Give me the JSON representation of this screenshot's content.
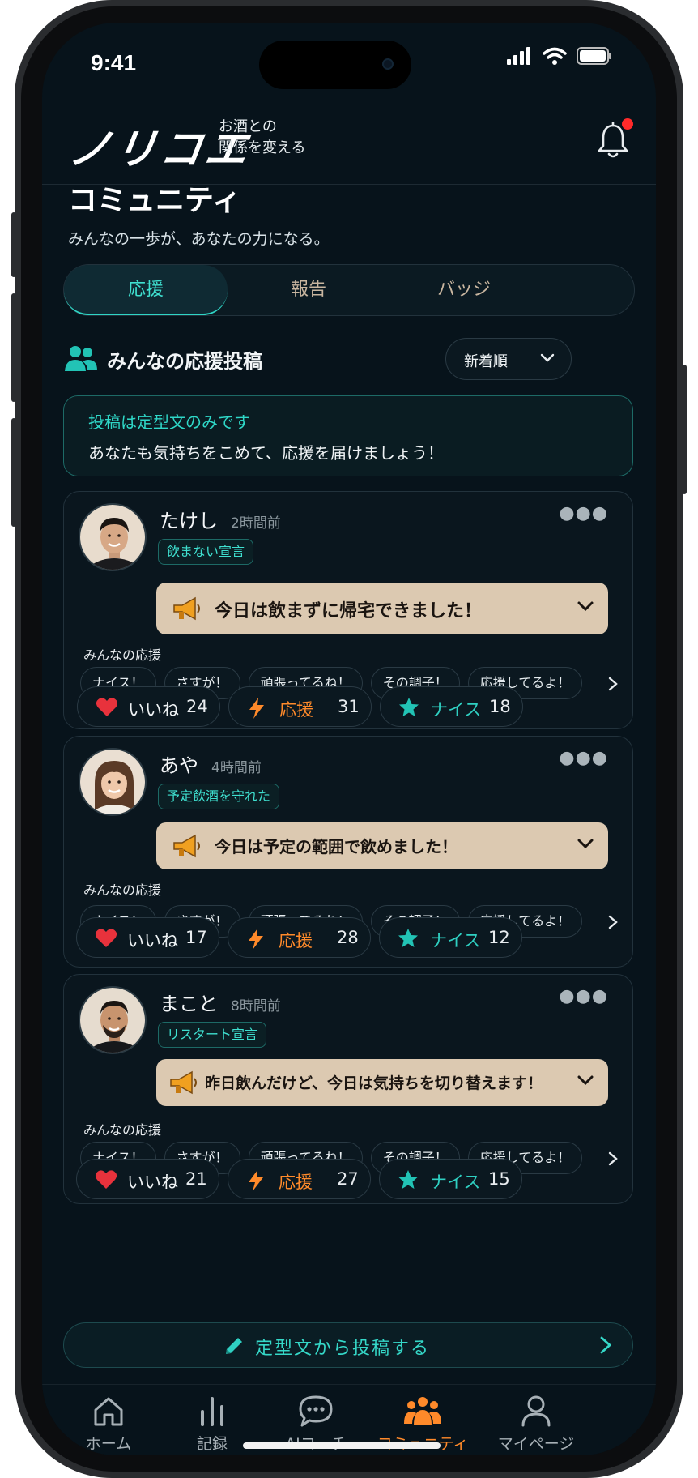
{
  "status": {
    "time": "9:41"
  },
  "header": {
    "logo": "ノリコエ",
    "tagline_1": "お酒との",
    "tagline_2": "関係を変える"
  },
  "page": {
    "title": "コミュニティ",
    "subtitle": "みんなの一歩が、あなたの力になる。"
  },
  "tabs": [
    {
      "label": "応援"
    },
    {
      "label": "報告"
    },
    {
      "label": "バッジ"
    }
  ],
  "section": {
    "title": "みんなの応援投稿",
    "sort": "新着順"
  },
  "notice": {
    "line1": "投稿は定型文のみです",
    "line2": "あなたも気持ちをこめて、応援を届けましょう！"
  },
  "cheer_label": "みんなの応援",
  "chips": [
    "ナイス！",
    "さすが！",
    "頑張ってるね！",
    "その調子！",
    "応援してるよ！"
  ],
  "action_labels": {
    "like": "いいね",
    "cheer": "応援",
    "nice": "ナイス"
  },
  "posts": [
    {
      "name": "たけし",
      "time": "2時間前",
      "tag": "飲まない宣言",
      "message": "今日は飲まずに帰宅できました！",
      "likes": "24",
      "cheers": "31",
      "nice": "18"
    },
    {
      "name": "あや",
      "time": "4時間前",
      "tag": "予定飲酒を守れた",
      "message": "今日は予定の範囲で飲めました！",
      "likes": "17",
      "cheers": "28",
      "nice": "12"
    },
    {
      "name": "まこと",
      "time": "8時間前",
      "tag": "リスタート宣言",
      "message": "昨日飲んだけど、今日は気持ちを切り替えます！",
      "likes": "21",
      "cheers": "27",
      "nice": "15"
    }
  ],
  "post_button": "定型文から投稿する",
  "nav": [
    {
      "label": "ホーム",
      "icon": "home-icon"
    },
    {
      "label": "記録",
      "icon": "chart-icon"
    },
    {
      "label": "AIコーチ",
      "icon": "chat-icon"
    },
    {
      "label": "コミュニティ",
      "icon": "community-icon"
    },
    {
      "label": "マイページ",
      "icon": "person-icon"
    }
  ],
  "colors": {
    "accent": "#2fd5c5",
    "orange": "#ff8a2a",
    "bg": "#07131b",
    "message_bg": "#dcc9b1",
    "heart": "#e8323c"
  }
}
